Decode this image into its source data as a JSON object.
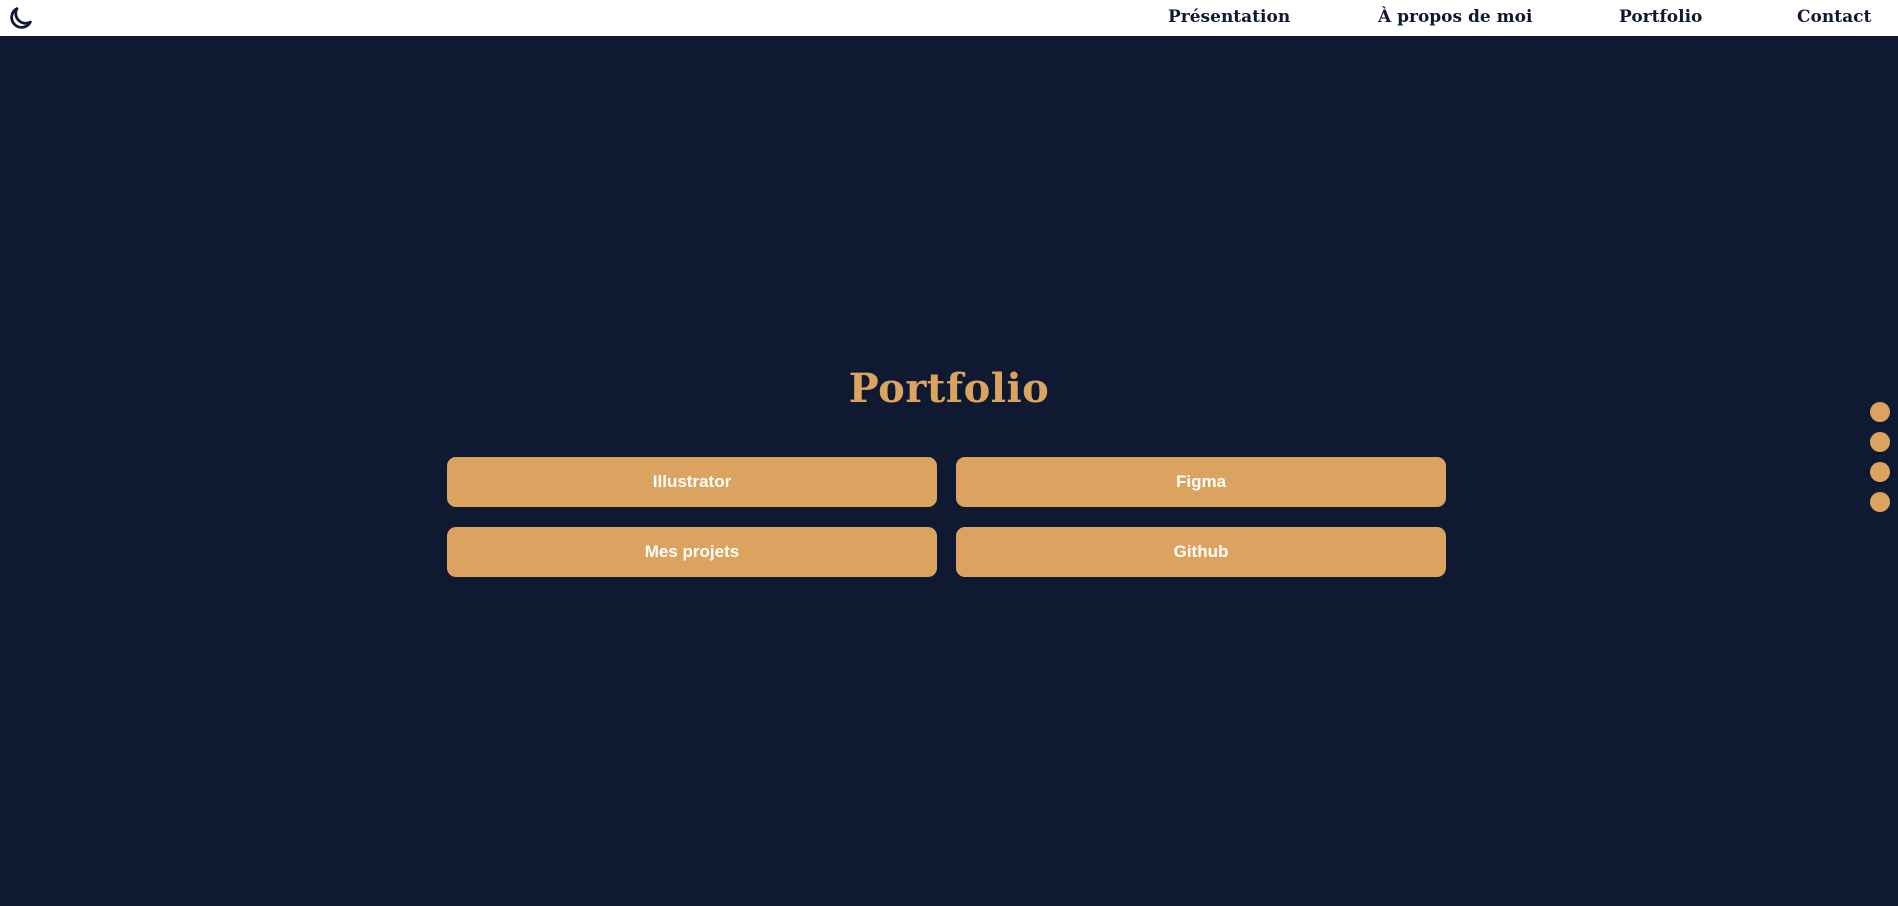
{
  "header": {
    "theme_toggle_icon": "moon-icon",
    "nav": [
      {
        "label": "Présentation"
      },
      {
        "label": "À propos de moi"
      },
      {
        "label": "Portfolio"
      },
      {
        "label": "Contact"
      }
    ]
  },
  "main": {
    "title": "Portfolio",
    "buttons": [
      {
        "label": "Illustrator"
      },
      {
        "label": "Figma"
      },
      {
        "label": "Mes projets"
      },
      {
        "label": "Github"
      }
    ]
  },
  "section_dots": {
    "count": 4
  },
  "colors": {
    "background": "#0f1932",
    "accent": "#dba35f",
    "header_background": "#ffffff",
    "button_text": "#ffffff"
  }
}
